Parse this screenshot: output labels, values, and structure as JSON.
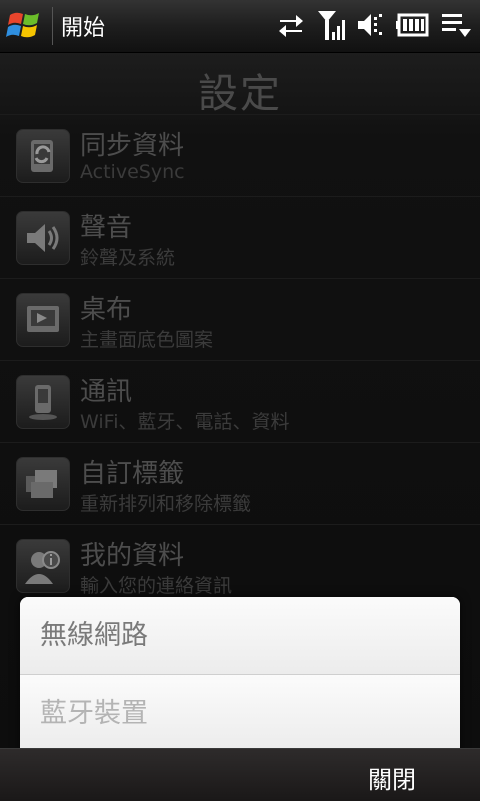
{
  "statusbar": {
    "title": "開始",
    "icons": [
      "windows-logo-icon",
      "sync-arrows-icon",
      "signal-icon",
      "volume-icon",
      "battery-icon",
      "menu-icon"
    ]
  },
  "page": {
    "title": "設定",
    "items": [
      {
        "title": "同步資料",
        "subtitle": "ActiveSync",
        "icon": "sync-icon"
      },
      {
        "title": "聲音",
        "subtitle": "鈴聲及系統",
        "icon": "speaker-icon"
      },
      {
        "title": "桌布",
        "subtitle": "主畫面底色圖案",
        "icon": "wallpaper-icon"
      },
      {
        "title": "通訊",
        "subtitle": "WiFi、藍牙、電話、資料",
        "icon": "phone-icon"
      },
      {
        "title": "自訂標籤",
        "subtitle": "重新排列和移除標籤",
        "icon": "tabs-icon"
      },
      {
        "title": "我的資料",
        "subtitle": "輸入您的連絡資訊",
        "icon": "contact-info-icon"
      }
    ]
  },
  "popup": {
    "items": [
      {
        "label": "無線網路"
      },
      {
        "label": "藍牙裝置"
      }
    ]
  },
  "softbar": {
    "right_label": "關閉"
  },
  "colors": {
    "popup_bg": "#f4f4f4",
    "bar_bg": "#1e1e1e"
  }
}
